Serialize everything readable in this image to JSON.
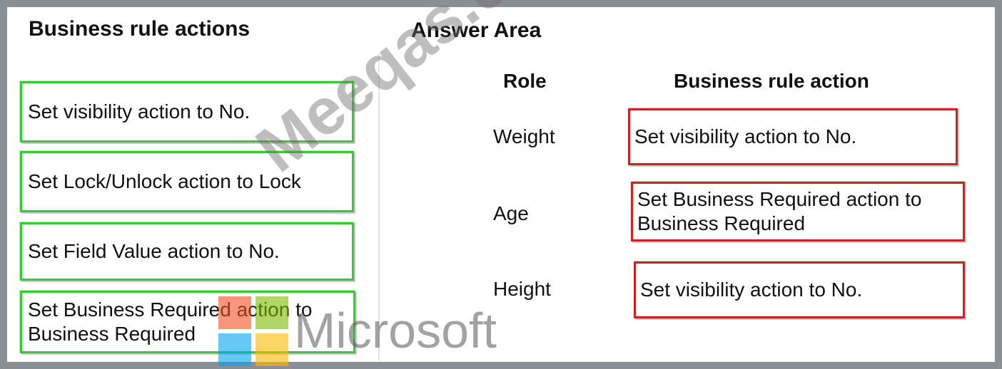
{
  "left_panel": {
    "title": "Business rule actions",
    "actions": [
      "Set visibility action to No.",
      "Set Lock/Unlock action to Lock",
      "Set Field Value action to No.",
      "Set Business Required action to Business Required"
    ]
  },
  "answer_area": {
    "title": "Answer Area",
    "role_header": "Role",
    "action_header": "Business rule action",
    "rows": [
      {
        "role": "Weight",
        "action": "Set visibility action to No."
      },
      {
        "role": "Age",
        "action": "Set Business Required action to Business Required"
      },
      {
        "role": "Height",
        "action": "Set visibility action to No."
      }
    ]
  },
  "watermarks": {
    "site": "Meeqas.com",
    "brand": "Microsoft"
  },
  "colors": {
    "source_border": "#33cc33",
    "answer_border": "#cc2222",
    "frame": "#8a8f96"
  }
}
